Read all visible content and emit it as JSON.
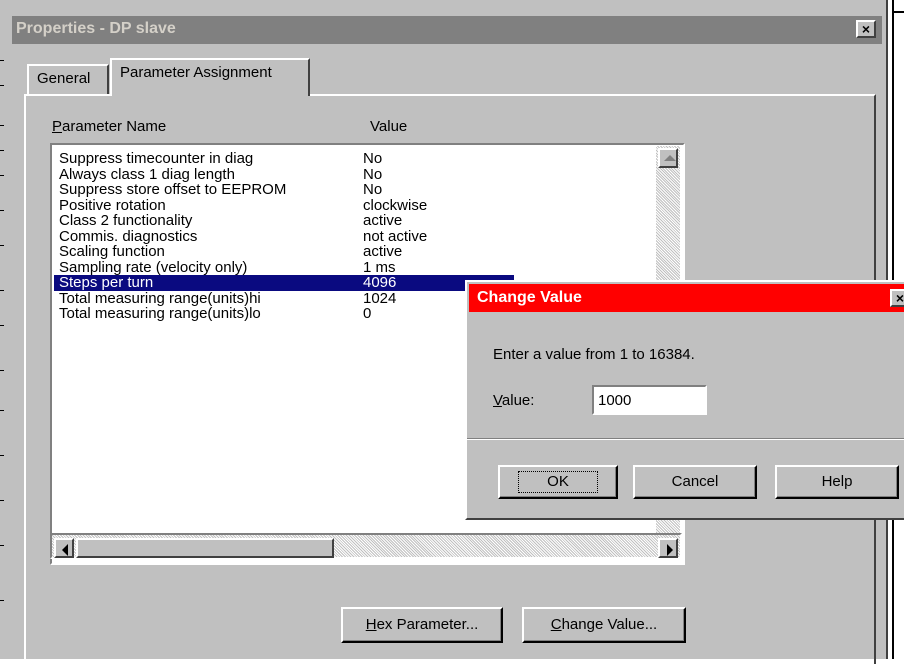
{
  "main_window": {
    "title": "Properties - DP slave",
    "close_glyph": "×"
  },
  "tabs": [
    {
      "label": "General"
    },
    {
      "label": "Parameter Assignment"
    }
  ],
  "columns": {
    "name_accel": "P",
    "name_rest": "arameter Name",
    "value": "Value"
  },
  "parameters": [
    {
      "name": "Suppress timecounter in diag",
      "value": "No"
    },
    {
      "name": "Always class 1 diag length",
      "value": "No"
    },
    {
      "name": "Suppress store offset to EEPROM",
      "value": "No"
    },
    {
      "name": "Positive rotation",
      "value": "clockwise"
    },
    {
      "name": "Class 2 functionality",
      "value": "active"
    },
    {
      "name": "Commis. diagnostics",
      "value": "not active"
    },
    {
      "name": "Scaling function",
      "value": "active"
    },
    {
      "name": "Sampling rate (velocity only)",
      "value": "1 ms"
    },
    {
      "name": "Steps per turn",
      "value": "4096"
    },
    {
      "name": "Total measuring range(units)hi",
      "value": "1024"
    },
    {
      "name": "Total measuring range(units)lo",
      "value": "0"
    }
  ],
  "selected_index": 8,
  "buttons": {
    "hex_accel": "H",
    "hex_rest": "ex Parameter...",
    "change_accel": "C",
    "change_rest": "hange Value..."
  },
  "dialog": {
    "title": "Change Value",
    "message": "Enter a value from 1  to  16384.",
    "label_accel": "V",
    "label_rest": "alue:",
    "input_value": "1000",
    "ok": "OK",
    "cancel": "Cancel",
    "help": "Help",
    "close_glyph": "×",
    "title_color": "#ff0000"
  },
  "colors": {
    "selection": "#0a0a80",
    "window_bg": "#c0c0c0",
    "inactive_title": "#808080"
  }
}
